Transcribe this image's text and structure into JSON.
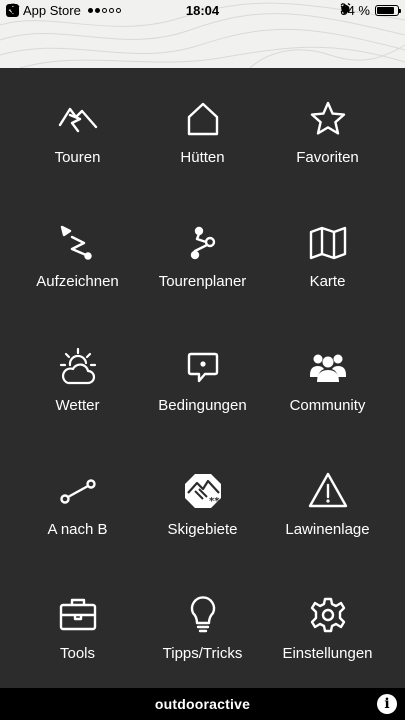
{
  "status_bar": {
    "back_label": "App Store",
    "time": "18:04",
    "battery": "84 %",
    "battery_level": 0.84,
    "signal_bars_filled": 2,
    "signal_bars_total": 5
  },
  "menu": {
    "items": [
      {
        "label": "Touren",
        "icon": "mountain-route-icon"
      },
      {
        "label": "Hütten",
        "icon": "hut-icon"
      },
      {
        "label": "Favoriten",
        "icon": "star-icon"
      },
      {
        "label": "Aufzeichnen",
        "icon": "record-track-icon"
      },
      {
        "label": "Tourenplaner",
        "icon": "route-planner-icon"
      },
      {
        "label": "Karte",
        "icon": "map-icon"
      },
      {
        "label": "Wetter",
        "icon": "weather-icon"
      },
      {
        "label": "Bedingungen",
        "icon": "conditions-icon"
      },
      {
        "label": "Community",
        "icon": "community-icon"
      },
      {
        "label": "A nach B",
        "icon": "a-to-b-icon"
      },
      {
        "label": "Skigebiete",
        "icon": "ski-area-icon"
      },
      {
        "label": "Lawinenlage",
        "icon": "avalanche-warning-icon"
      },
      {
        "label": "Tools",
        "icon": "toolbox-icon"
      },
      {
        "label": "Tipps/Tricks",
        "icon": "lightbulb-icon"
      },
      {
        "label": "Einstellungen",
        "icon": "gear-icon"
      }
    ]
  },
  "bottom_bar": {
    "brand": "outdooractive",
    "info_icon": "info-icon"
  },
  "colors": {
    "background": "#2c2c2c",
    "bottom_bar": "#000000",
    "text": "#ffffff"
  }
}
